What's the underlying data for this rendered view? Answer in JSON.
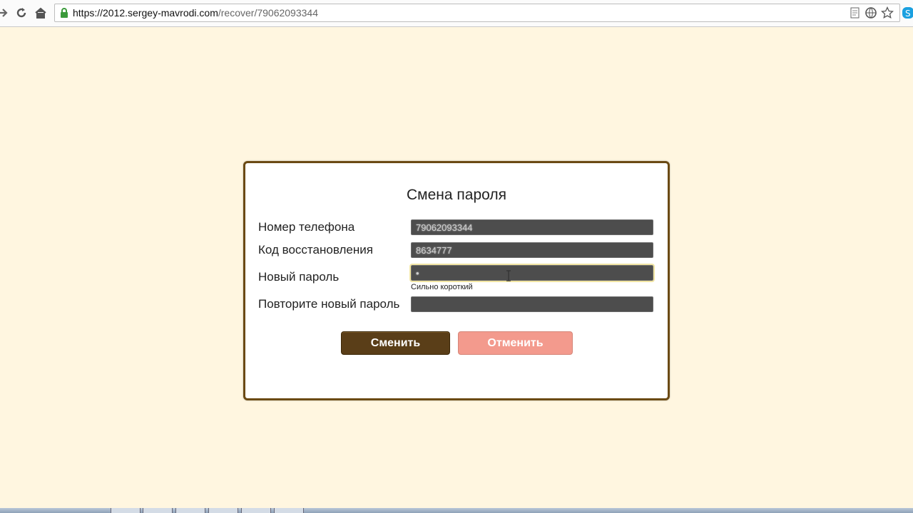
{
  "browser": {
    "url_host": "https://2012.sergey-mavrodi.com",
    "url_path": "/recover/79062093344"
  },
  "dialog": {
    "title": "Смена пароля",
    "fields": [
      {
        "label": "Номер телефона",
        "value": "79062093344"
      },
      {
        "label": "Код восстановления",
        "value": "8634777"
      },
      {
        "label": "Новый пароль",
        "value": "•"
      },
      {
        "label": "Повторите новый пароль",
        "value": ""
      }
    ],
    "password_strength": "Сильно короткий",
    "submit_label": "Сменить",
    "cancel_label": "Отменить"
  },
  "colors": {
    "page_background": "#fff6e0",
    "dialog_border": "#6b4a14",
    "submit_button": "#5a3e18",
    "cancel_button": "#f39a8d"
  }
}
